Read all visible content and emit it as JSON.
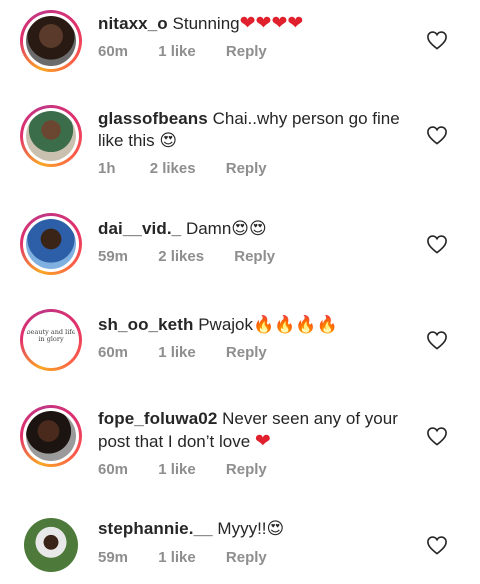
{
  "comments": [
    {
      "username": "nitaxx_o",
      "text": " Stunning",
      "emoji": "❤❤❤❤",
      "time": "60m",
      "likes": "1 like",
      "reply": "Reply"
    },
    {
      "username": "glassofbeans",
      "text": " Chai..why person go fine like this ",
      "emoji": "😍",
      "time": "1h",
      "likes": "2 likes",
      "reply": "Reply"
    },
    {
      "username": "dai__vid._",
      "text": " Damn",
      "emoji": "😍😍",
      "time": "59m",
      "likes": "2 likes",
      "reply": "Reply"
    },
    {
      "username": "sh_oo_keth",
      "text": " Pwajok",
      "emoji": "🔥🔥🔥🔥",
      "time": "60m",
      "likes": "1 like",
      "reply": "Reply",
      "avatar_text": "beauty and life in glory"
    },
    {
      "username": "fope_foluwa02",
      "text": " Never seen any of your post that I don’t love ",
      "emoji": "❤",
      "time": "60m",
      "likes": "1 like",
      "reply": "Reply"
    },
    {
      "username": "stephannie.__",
      "text": " Myyy!!",
      "emoji": "😍",
      "time": "59m",
      "likes": "1 like",
      "reply": "Reply"
    }
  ],
  "colors": {
    "text": "#262626",
    "meta": "#8e8e8e",
    "heart": "#e0202c",
    "ring_start": "#f9a825",
    "ring_end": "#c13584"
  },
  "icons": {
    "like": "heart-outline-icon"
  }
}
